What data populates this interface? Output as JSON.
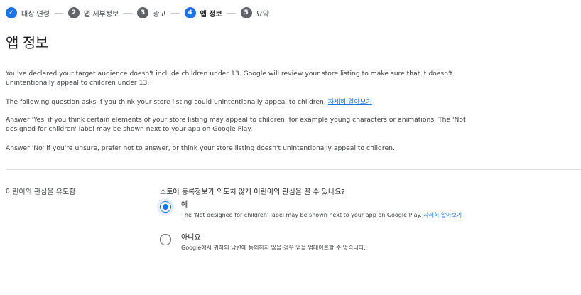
{
  "stepper": {
    "steps": [
      {
        "number": "",
        "label": "대상 연령",
        "state": "done"
      },
      {
        "number": "2",
        "label": "앱 세부정보",
        "state": "todo"
      },
      {
        "number": "3",
        "label": "광고",
        "state": "todo"
      },
      {
        "number": "4",
        "label": "앱 정보",
        "state": "active"
      },
      {
        "number": "5",
        "label": "요약",
        "state": "todo"
      }
    ],
    "check_glyph": "✓"
  },
  "page": {
    "title": "앱 정보"
  },
  "intro": {
    "p1": "You've declared your target audience doesn't include children under 13. Google will review your store listing to make sure that it doesn't unintentionally appeal to children under 13.",
    "p2_text": "The following question asks if you think your store listing could unintentionally appeal to children. ",
    "p2_link": "자세히 알아보기",
    "p3": "Answer 'Yes' if you think certain elements of your store listing may appeal to children, for example young characters or animations. The 'Not designed for children' label may be shown next to your app on Google Play.",
    "p4": "Answer 'No' if you're unsure, prefer not to answer, or think your store listing doesn't unintentionally appeal to children."
  },
  "section": {
    "label": "어린이의 관심을 유도함",
    "question": "스토어 등록정보가 의도치 않게 어린이의 관심을 끌 수 있나요?",
    "options": [
      {
        "title": "예",
        "desc": "The 'Not designed for children' label may be shown next to your app on Google Play. ",
        "link": "자세히 알아보기",
        "checked": true
      },
      {
        "title": "아니요",
        "desc": "Google에서 귀하의 답변에 동의하지 않을 경우 앱을 업데이트할 수 없습니다.",
        "checked": false
      }
    ]
  },
  "colors": {
    "accent": "#1a73e8",
    "step_inactive": "#5f6368",
    "text": "#3c4043",
    "divider": "#dadce0"
  }
}
